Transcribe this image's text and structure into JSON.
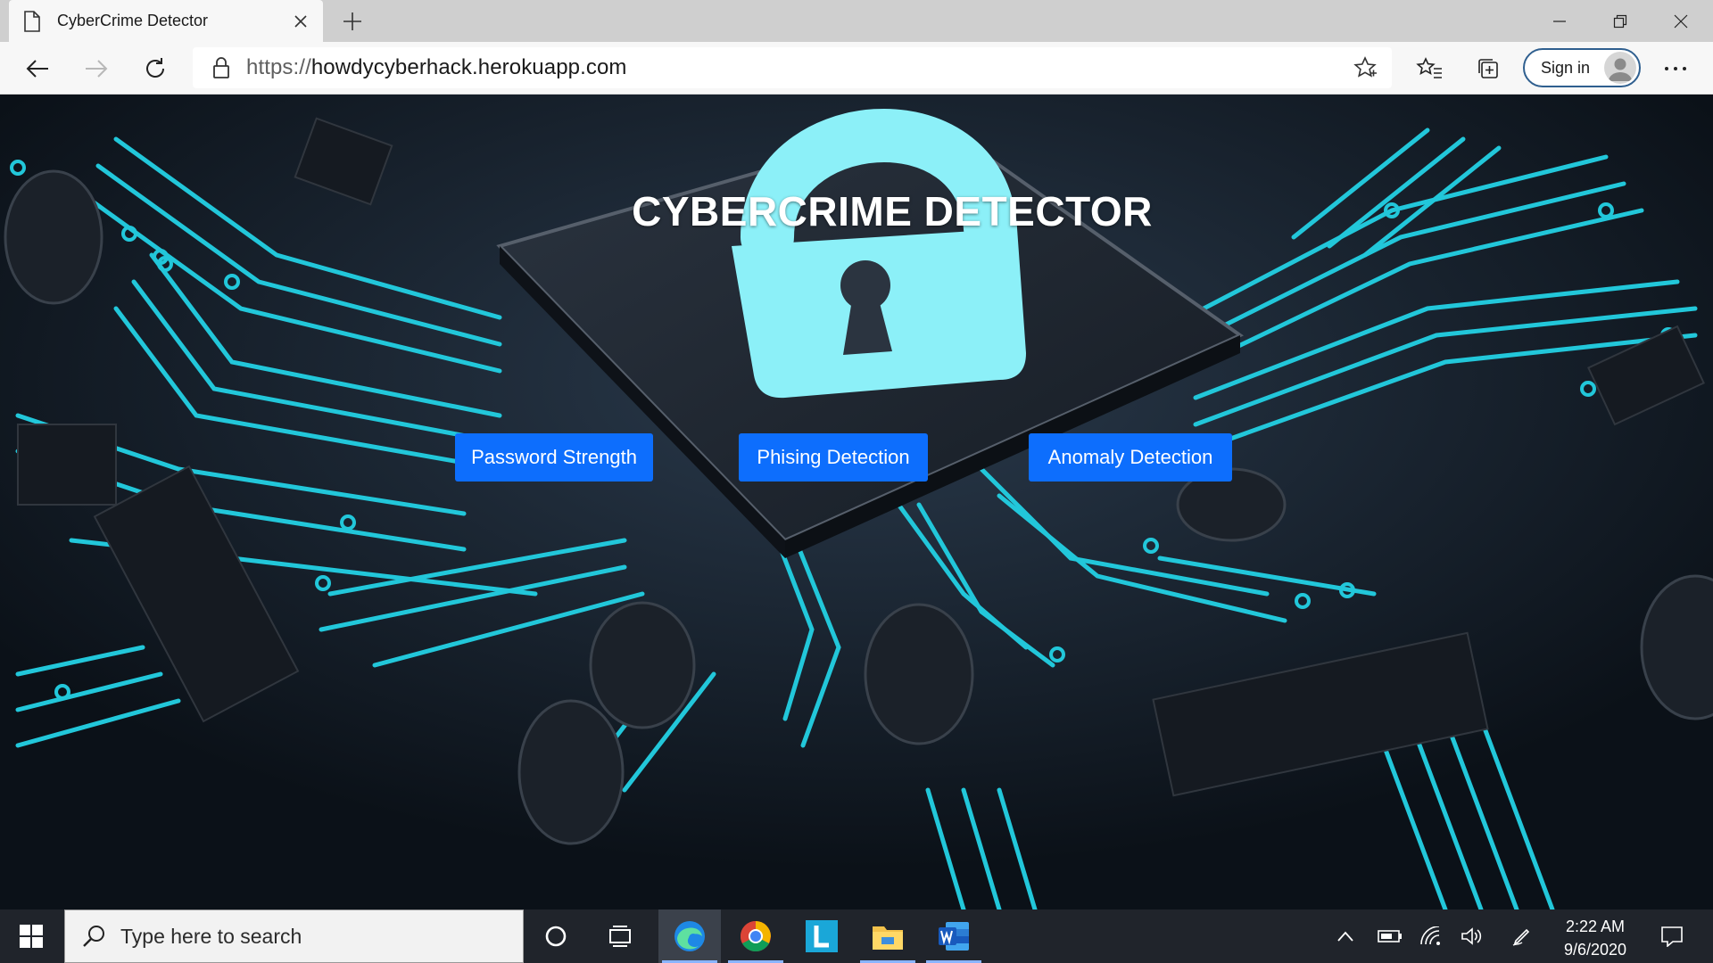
{
  "browser": {
    "tab_title": "CyberCrime Detector",
    "url_scheme": "https://",
    "url_host": "howdycyberhack.herokuapp.com",
    "sign_in_label": "Sign in"
  },
  "page": {
    "title": "CYBERCRIME DETECTOR",
    "buttons": {
      "password": "Password Strength",
      "phishing": "Phising Detection",
      "anomaly": "Anomaly Detection"
    },
    "accent_color": "#0d6efd"
  },
  "taskbar": {
    "search_placeholder": "Type here to search",
    "time": "2:22 AM",
    "date": "9/6/2020",
    "apps": [
      "edge-icon",
      "chrome-icon",
      "l-app-icon",
      "file-explorer-icon",
      "word-icon"
    ]
  }
}
